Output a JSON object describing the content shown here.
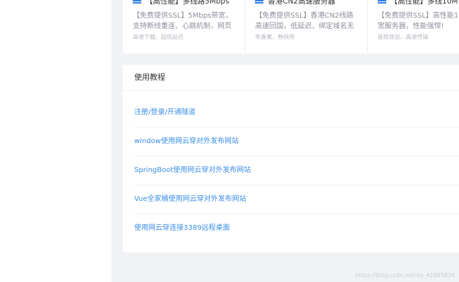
{
  "cards": [
    {
      "title": "【高性能】多线路5Mbps",
      "desc": "【免费提供SSL】5Mbps带宽，支持断线重连、心跳机制，网页秒开、",
      "tags": "高速下载、超低延迟"
    },
    {
      "title": "香港CN2高速服务器",
      "desc": "【免费提供SSL】香港CN2线路高速回国，低延迟，绑定域名无需备案",
      "tags": "免备案、畅快用"
    },
    {
      "title": "【高性能】多线10M",
      "desc": "【免费提供SSL】高性能10M带宽服务器，性能强悍!",
      "tags": "极致体验、高速传输"
    }
  ],
  "tutorials": {
    "title": "使用教程",
    "items": [
      {
        "label": "注册/登录/开通隧道"
      },
      {
        "label": "window使用网云穿对外发布网站"
      },
      {
        "label": "SpringBoot使用网云穿对外发布网站"
      },
      {
        "label": "Vue全家桶使用网云穿对外发布网站"
      },
      {
        "label": "使用网云穿连接3389远程桌面"
      }
    ]
  },
  "watermark": "https://blog.csdn.net/qq_41905834",
  "colors": {
    "accent": "#3a8ee6",
    "icon": "#2d7ae5",
    "background": "#f0f2f5"
  }
}
